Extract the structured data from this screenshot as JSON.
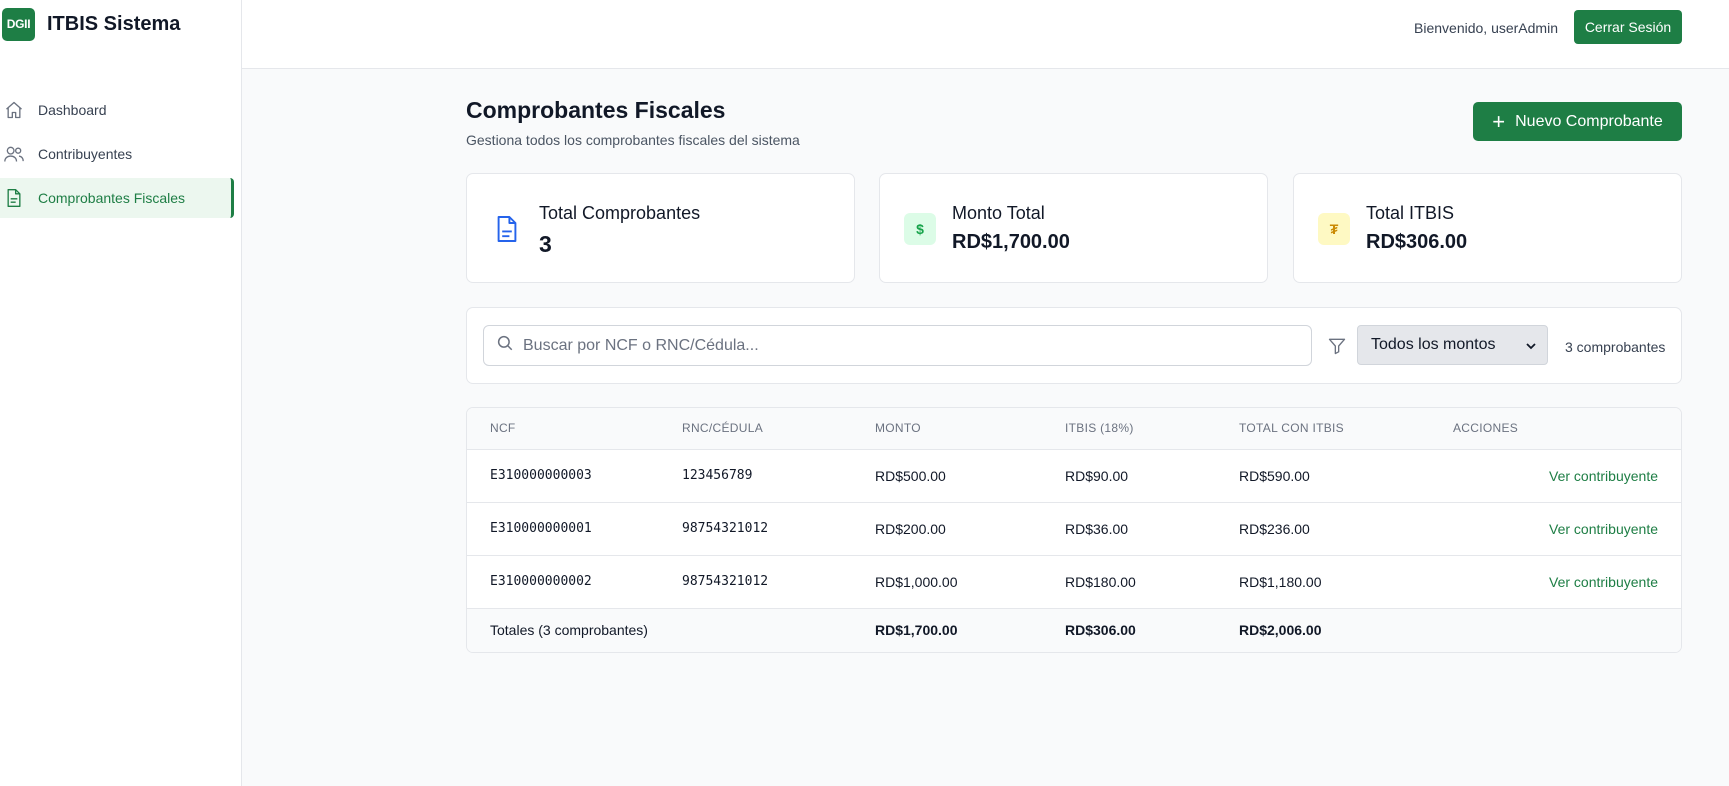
{
  "brand": {
    "logo_text": "DGII",
    "title": "ITBIS Sistema",
    "accent_color": "#1e7e45"
  },
  "sidebar": {
    "items": [
      {
        "label": "Dashboard",
        "icon": "home-icon",
        "active": false
      },
      {
        "label": "Contribuyentes",
        "icon": "users-icon",
        "active": false
      },
      {
        "label": "Comprobantes Fiscales",
        "icon": "document-icon",
        "active": true
      }
    ]
  },
  "header": {
    "welcome": "Bienvenido, userAdmin",
    "logout_label": "Cerrar Sesión"
  },
  "main": {
    "title": "Comprobantes Fiscales",
    "subtitle": "Gestiona todos los comprobantes fiscales del sistema",
    "new_button_label": "Nuevo Comprobante"
  },
  "stats": [
    {
      "label": "Total Comprobantes",
      "value": "3",
      "icon": "file-text-icon",
      "icon_color": "#2563eb",
      "icon_bg": "#ffffff"
    },
    {
      "label": "Monto Total",
      "value": "RD$1,700.00",
      "icon": "dollar-icon",
      "icon_color": "#16a34a",
      "icon_bg": "#dcfce7"
    },
    {
      "label": "Total ITBIS",
      "value": "RD$306.00",
      "icon": "tax-icon",
      "icon_color": "#ca8a04",
      "icon_bg": "#fef9c3"
    }
  ],
  "filters": {
    "search_placeholder": "Buscar por NCF o RNC/Cédula...",
    "amount_filter_selected": "Todos los montos",
    "count_label": "3 comprobantes"
  },
  "table": {
    "headers": [
      "NCF",
      "RNC/Cédula",
      "Monto",
      "ITBIS (18%)",
      "Total con ITBIS",
      "Acciones"
    ],
    "rows": [
      {
        "ncf": "E310000000003",
        "rnc": "123456789",
        "monto": "RD$500.00",
        "itbis": "RD$90.00",
        "total": "RD$590.00",
        "action": "Ver contribuyente"
      },
      {
        "ncf": "E310000000001",
        "rnc": "98754321012",
        "monto": "RD$200.00",
        "itbis": "RD$36.00",
        "total": "RD$236.00",
        "action": "Ver contribuyente"
      },
      {
        "ncf": "E310000000002",
        "rnc": "98754321012",
        "monto": "RD$1,000.00",
        "itbis": "RD$180.00",
        "total": "RD$1,180.00",
        "action": "Ver contribuyente"
      }
    ],
    "footer": {
      "label": "Totales (3 comprobantes)",
      "monto": "RD$1,700.00",
      "itbis": "RD$306.00",
      "total": "RD$2,006.00"
    }
  }
}
